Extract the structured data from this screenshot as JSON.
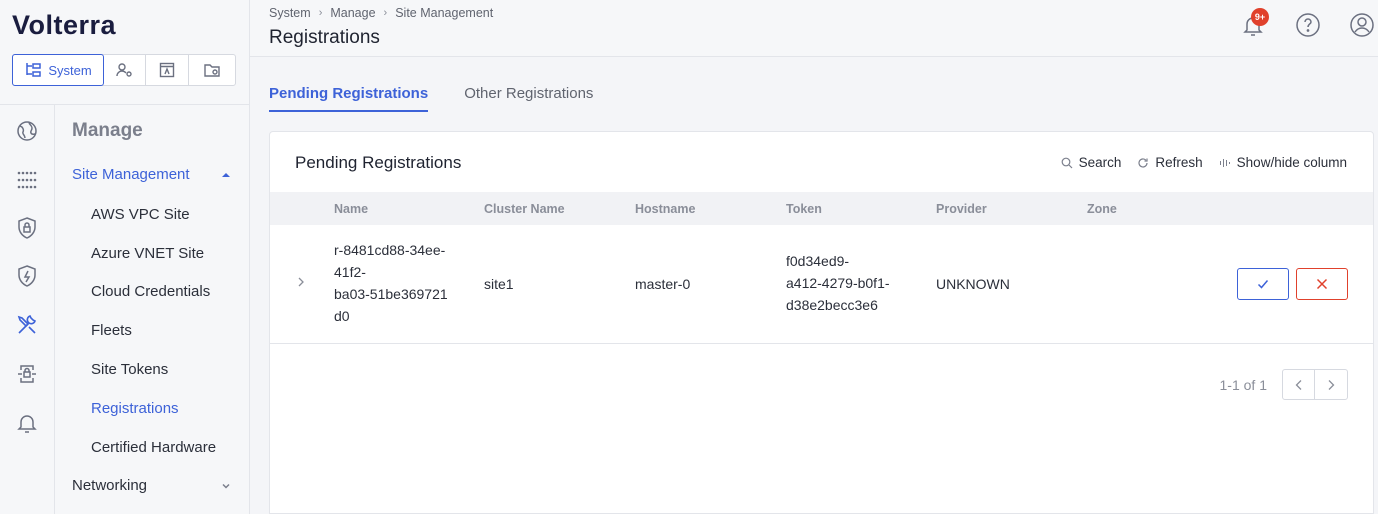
{
  "app": {
    "logo_text": "Volterra"
  },
  "workspace_switcher": {
    "active_label": "System"
  },
  "sidebar": {
    "heading": "Manage",
    "groups": [
      {
        "label": "Site Management",
        "expanded": true
      },
      {
        "label": "Networking",
        "expanded": false
      }
    ],
    "items": [
      {
        "label": "AWS VPC Site"
      },
      {
        "label": "Azure VNET Site"
      },
      {
        "label": "Cloud Credentials"
      },
      {
        "label": "Fleets"
      },
      {
        "label": "Site Tokens"
      },
      {
        "label": "Registrations",
        "active": true
      },
      {
        "label": "Certified Hardware"
      }
    ],
    "rail_icons": [
      "globe-icon",
      "network-icon",
      "shield-lock-icon",
      "shield-bolt-icon",
      "tools-icon",
      "secure-transfer-icon",
      "bell-icon"
    ]
  },
  "header": {
    "breadcrumb": [
      "System",
      "Manage",
      "Site Management"
    ],
    "title": "Registrations",
    "notification_badge": "9+"
  },
  "tabs": [
    {
      "label": "Pending Registrations",
      "active": true
    },
    {
      "label": "Other Registrations",
      "active": false
    }
  ],
  "card": {
    "title": "Pending Registrations",
    "toolbar": {
      "search": "Search",
      "refresh": "Refresh",
      "columns": "Show/hide column"
    },
    "columns": [
      "Name",
      "Cluster Name",
      "Hostname",
      "Token",
      "Provider",
      "Zone"
    ],
    "rows": [
      {
        "name_lines": [
          "r-8481cd88-34ee-",
          "41f2-",
          "ba03-51be369721",
          "d0"
        ],
        "cluster_name": "site1",
        "hostname": "master-0",
        "token_lines": [
          "f0d34ed9-",
          "a412-4279-b0f1-",
          "d38e2becc3e6"
        ],
        "provider": "UNKNOWN",
        "zone": ""
      }
    ],
    "pagination": "1-1 of 1"
  },
  "colors": {
    "accent": "#3d62d8",
    "danger": "#e0412c"
  }
}
